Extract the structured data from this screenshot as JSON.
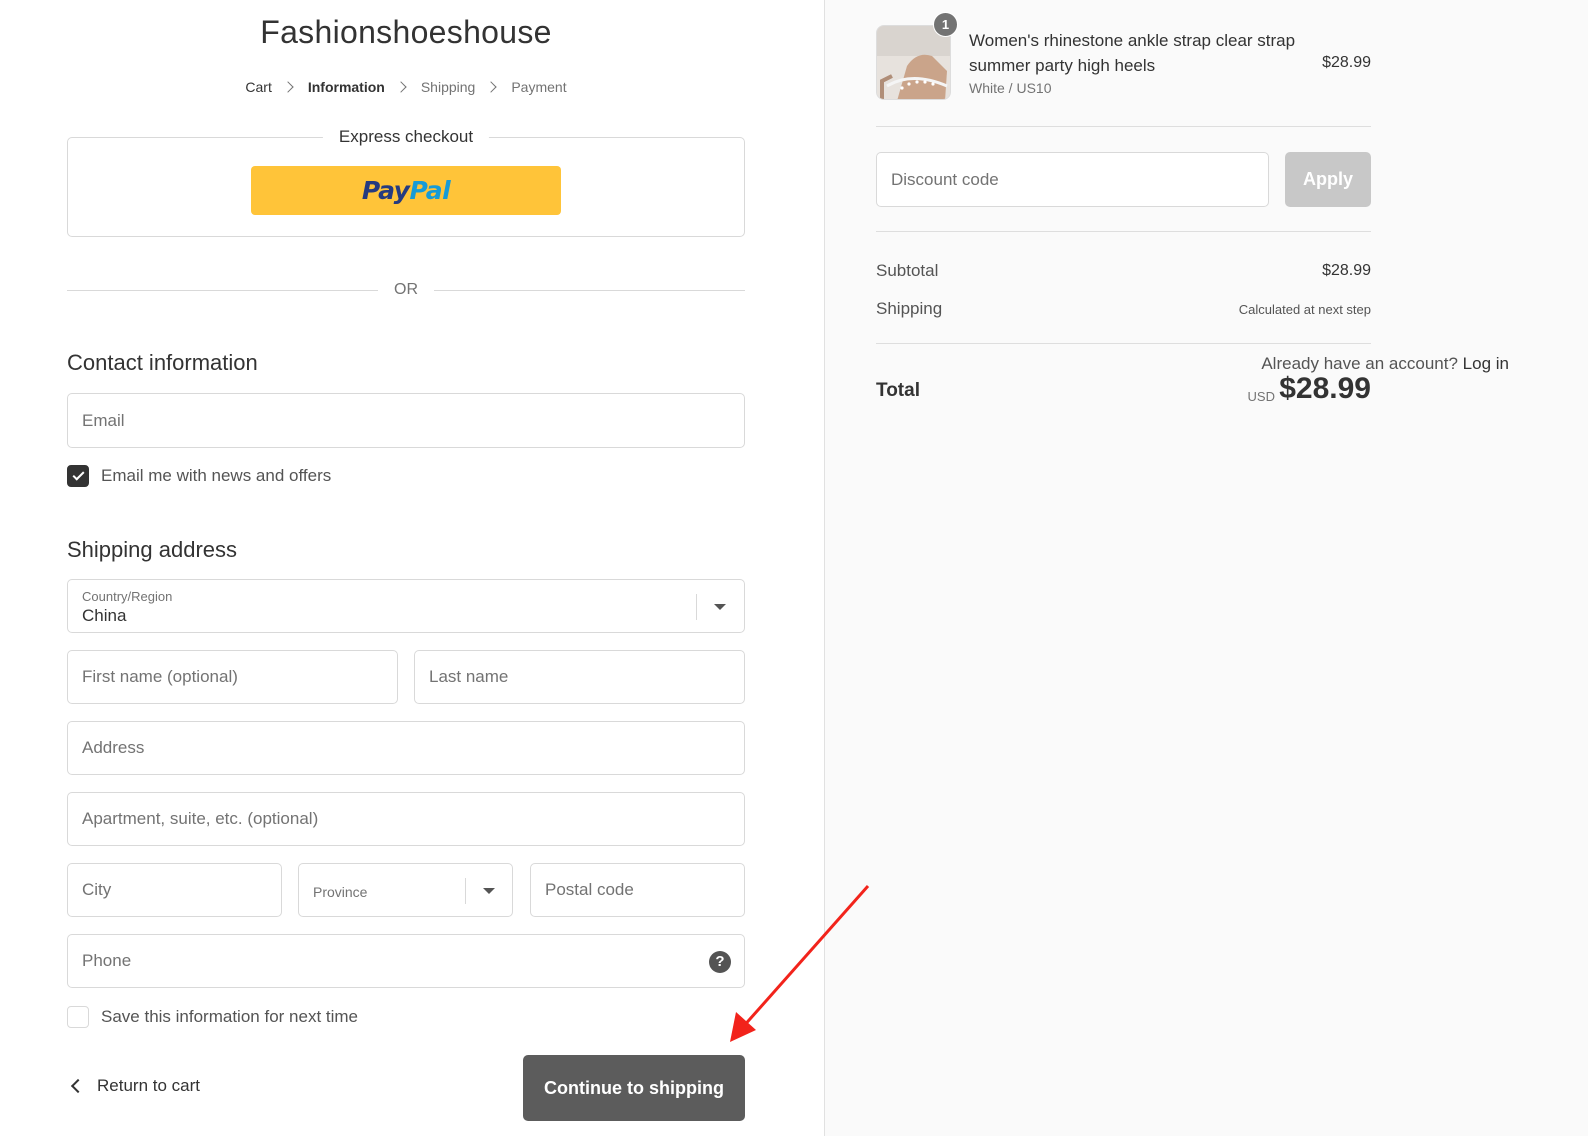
{
  "store": {
    "name": "Fashionshoeshouse"
  },
  "breadcrumb": {
    "cart": "Cart",
    "information": "Information",
    "shipping": "Shipping",
    "payment": "Payment"
  },
  "express": {
    "label": "Express checkout",
    "paypal_pay": "Pay",
    "paypal_pal": "Pal"
  },
  "or_text": "OR",
  "contact": {
    "title": "Contact information",
    "account_prompt": "Already have an account?",
    "login_label": "Log in",
    "email_placeholder": "Email",
    "news_label": "Email me with news and offers",
    "news_checked": true
  },
  "shipping": {
    "title": "Shipping address",
    "country_label": "Country/Region",
    "country_value": "China",
    "first_name_placeholder": "First name (optional)",
    "last_name_placeholder": "Last name",
    "address_placeholder": "Address",
    "apartment_placeholder": "Apartment, suite, etc. (optional)",
    "city_placeholder": "City",
    "province_placeholder": "Province",
    "postal_placeholder": "Postal code",
    "phone_placeholder": "Phone",
    "save_label": "Save this information for next time",
    "save_checked": false
  },
  "actions": {
    "return_label": "Return to cart",
    "continue_label": "Continue to shipping"
  },
  "order": {
    "quantity": "1",
    "product_name": "Women's rhinestone ankle strap clear strap summer party high heels",
    "variant": "White / US10",
    "price": "$28.99",
    "discount_placeholder": "Discount code",
    "apply_label": "Apply",
    "subtotal_label": "Subtotal",
    "subtotal_value": "$28.99",
    "shipping_label": "Shipping",
    "shipping_value": "Calculated at next step",
    "total_label": "Total",
    "currency": "USD",
    "total_value": "$28.99"
  },
  "colors": {
    "button_dark": "#5c5c5c",
    "paypal_yellow": "#ffc439",
    "annotation_arrow": "#f2231b"
  }
}
